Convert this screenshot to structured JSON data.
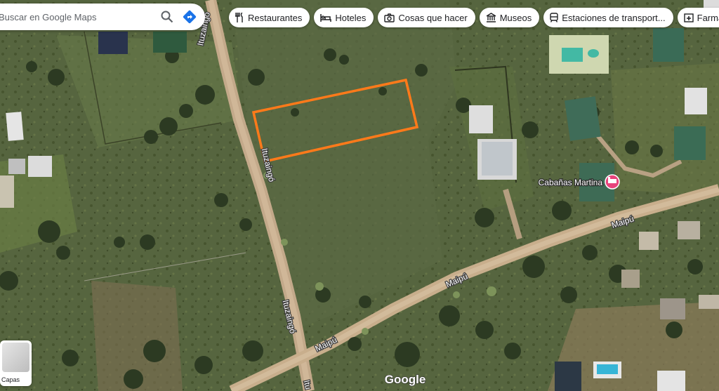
{
  "search": {
    "placeholder": "Buscar en Google Maps"
  },
  "chips": [
    {
      "label": "Restaurantes",
      "icon": "fork-knife-icon"
    },
    {
      "label": "Hoteles",
      "icon": "bed-icon"
    },
    {
      "label": "Cosas que hacer",
      "icon": "camera-icon"
    },
    {
      "label": "Museos",
      "icon": "museum-icon"
    },
    {
      "label": "Estaciones de transport...",
      "icon": "train-icon"
    },
    {
      "label": "Farmacias",
      "icon": "pharmacy-icon"
    }
  ],
  "map": {
    "streets": {
      "ituzaingo_top": "Ituzaingó",
      "ituzaingo_mid": "Ituzaingó",
      "ituzaingo_low": "Ituzaingó",
      "ituzaingo_bottom": "Itu",
      "maipu_right": "Maipú",
      "maipu_mid": "Maipú",
      "maipu_left": "Maipú"
    },
    "poi": {
      "name": "Cabañas Martina",
      "color": "#e8437c"
    },
    "highlight_color": "#ff7a1a",
    "attribution": "Google"
  },
  "layers": {
    "label": "Capas"
  },
  "colors": {
    "directions": "#1a73e8"
  }
}
